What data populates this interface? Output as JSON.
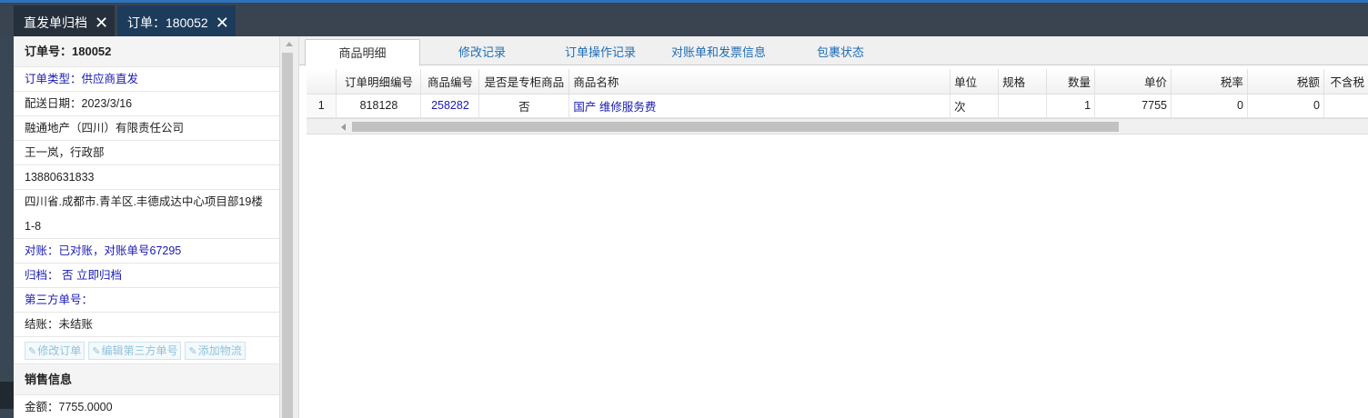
{
  "tabs": [
    {
      "label": "直发单归档",
      "close": "✕"
    },
    {
      "label": "订单：180052",
      "close": "✕"
    }
  ],
  "left": {
    "order_no": "订单号：180052",
    "order_type": "订单类型：供应商直发",
    "delivery_date": "配送日期：2023/3/16",
    "company": "融通地产（四川）有限责任公司",
    "contact": "王一岚，行政部",
    "phone": "13880631833",
    "address": "四川省.成都市.青羊区.丰德成达中心项目部19楼1-8",
    "reconcile": "对账：已对账，对账单号67295",
    "archive_prefix": "归档：",
    "archive_value": "否",
    "archive_link": "立即归档",
    "third_party": "第三方单号：",
    "settlement": "结账：未结账",
    "buttons": [
      "修改订单",
      "编辑第三方单号",
      "添加物流"
    ],
    "sales_header": "销售信息",
    "amount": "金额：7755.0000"
  },
  "main_tabs": [
    "商品明细",
    "修改记录",
    "订单操作记录",
    "对账单和发票信息",
    "包裹状态"
  ],
  "grid": {
    "headers": [
      "",
      "订单明细编号",
      "商品编号",
      "是否是专柜商品",
      "商品名称",
      "单位",
      "规格",
      "数量",
      "单价",
      "税率",
      "税额",
      "不含税"
    ],
    "rows": [
      [
        "1",
        "818128",
        "258282",
        "否",
        "国产 维修服务费",
        "次",
        "",
        "1",
        "7755",
        "0",
        "0",
        ""
      ]
    ]
  },
  "icons": {
    "edit": "pencil-icon",
    "close": "close-icon"
  },
  "colors": {
    "topbar": "#3a4451",
    "active_tab": "#1d3c5c",
    "link": "#1a1ab0",
    "tab_link": "#1f6db5"
  }
}
